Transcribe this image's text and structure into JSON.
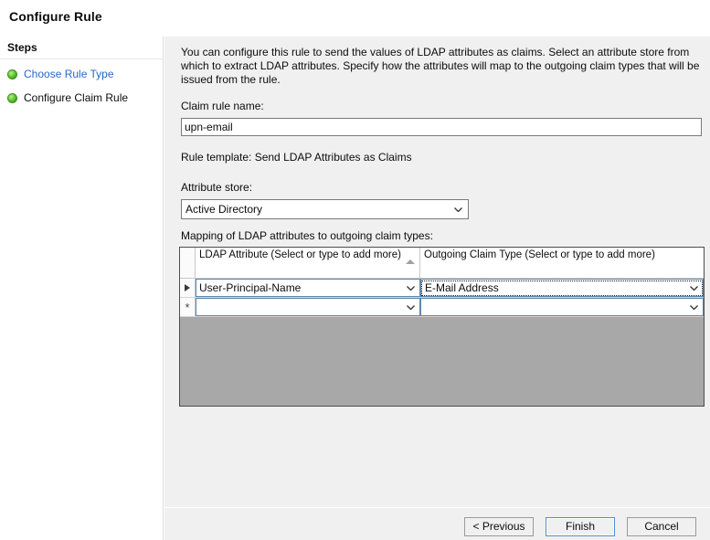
{
  "window": {
    "title": "Configure Rule"
  },
  "sidebar": {
    "header": "Steps",
    "items": [
      {
        "label": "Choose Rule Type",
        "state": "link",
        "bullet": "green-dot-icon"
      },
      {
        "label": "Configure Claim Rule",
        "state": "current",
        "bullet": "green-dot-icon"
      }
    ]
  },
  "main": {
    "description": "You can configure this rule to send the values of LDAP attributes as claims. Select an attribute store from which to extract LDAP attributes. Specify how the attributes will map to the outgoing claim types that will be issued from the rule.",
    "claim_rule_name_label": "Claim rule name:",
    "claim_rule_name_value": "upn-email",
    "claim_rule_name_placeholder": "",
    "rule_template_label": "Rule template: Send LDAP Attributes as Claims",
    "attribute_store_label": "Attribute store:",
    "attribute_store_value": "Active Directory",
    "attribute_store_options": [
      "Active Directory"
    ],
    "mapping_label": "Mapping of LDAP attributes to outgoing claim types:",
    "grid": {
      "columns": [
        {
          "header": "LDAP Attribute (Select or type to add more)",
          "sort": "ascending",
          "sort_icon": "sort-ascending-icon"
        },
        {
          "header": "Outgoing Claim Type (Select or type to add more)",
          "sort": "none"
        }
      ],
      "rows": [
        {
          "marker": "▶",
          "marker_icon": "row-selector-arrow-icon",
          "ldap_attribute": "User-Principal-Name",
          "outgoing_claim_type": "E-Mail Address",
          "focused_cell": "outgoing_claim_type"
        },
        {
          "marker": "*",
          "marker_icon": "new-row-asterisk-icon",
          "ldap_attribute": "",
          "outgoing_claim_type": "",
          "focused_cell": ""
        }
      ]
    }
  },
  "footer": {
    "previous_label": "< Previous",
    "finish_label": "Finish",
    "cancel_label": "Cancel",
    "default_button": "Finish"
  },
  "colors": {
    "panel_background": "#f0f0f0",
    "grid_empty_area": "#a8a8a8",
    "link_text": "#2667c9",
    "step_bullet_green": "#5cb32b",
    "default_button_border": "#4f8fd0",
    "cell_border_blue": "#5f87ab"
  }
}
